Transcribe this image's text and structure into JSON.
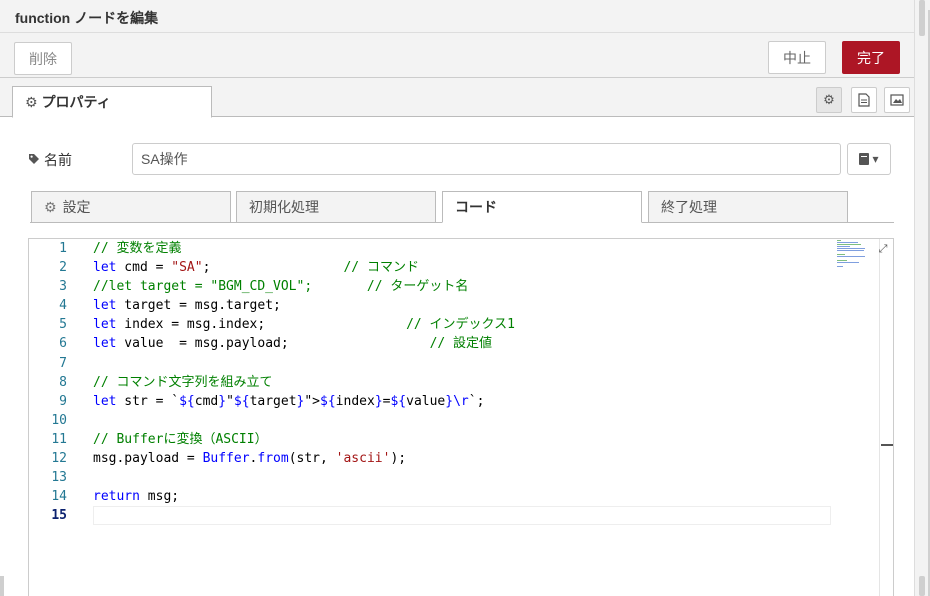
{
  "dialog": {
    "title": "function ノードを編集"
  },
  "toolbar": {
    "delete_label": "削除",
    "cancel_label": "中止",
    "done_label": "完了"
  },
  "tabs": {
    "properties_label": "プロパティ"
  },
  "name_field": {
    "label": "名前",
    "value": "SA操作"
  },
  "subtabs": [
    {
      "label": "設定"
    },
    {
      "label": "初期化処理"
    },
    {
      "label": "コード"
    },
    {
      "label": "終了処理"
    }
  ],
  "editor": {
    "current_line": 15,
    "lines": [
      {
        "n": "1",
        "text": "// 変数を定義"
      },
      {
        "n": "2",
        "text": "let cmd = \"SA\";                 // コマンド"
      },
      {
        "n": "3",
        "text": "//let target = \"BGM_CD_VOL\";       // ターゲット名"
      },
      {
        "n": "4",
        "text": "let target = msg.target;"
      },
      {
        "n": "5",
        "text": "let index = msg.index;                  // インデックス1"
      },
      {
        "n": "6",
        "text": "let value  = msg.payload;                  // 設定値"
      },
      {
        "n": "7",
        "text": ""
      },
      {
        "n": "8",
        "text": "// コマンド文字列を組み立て"
      },
      {
        "n": "9",
        "text": "let str = `${cmd}\"${target}\">${index}=${value}\\r`;"
      },
      {
        "n": "10",
        "text": ""
      },
      {
        "n": "11",
        "text": "// Bufferに変換（ASCII）"
      },
      {
        "n": "12",
        "text": "msg.payload = Buffer.from(str, 'ascii');"
      },
      {
        "n": "13",
        "text": ""
      },
      {
        "n": "14",
        "text": "return msg;"
      },
      {
        "n": "15",
        "text": ""
      }
    ]
  },
  "colors": {
    "accent": "#ad1625",
    "comment": "#008000",
    "keyword": "#0000ff",
    "string": "#a31515",
    "line_number": "#237893"
  }
}
